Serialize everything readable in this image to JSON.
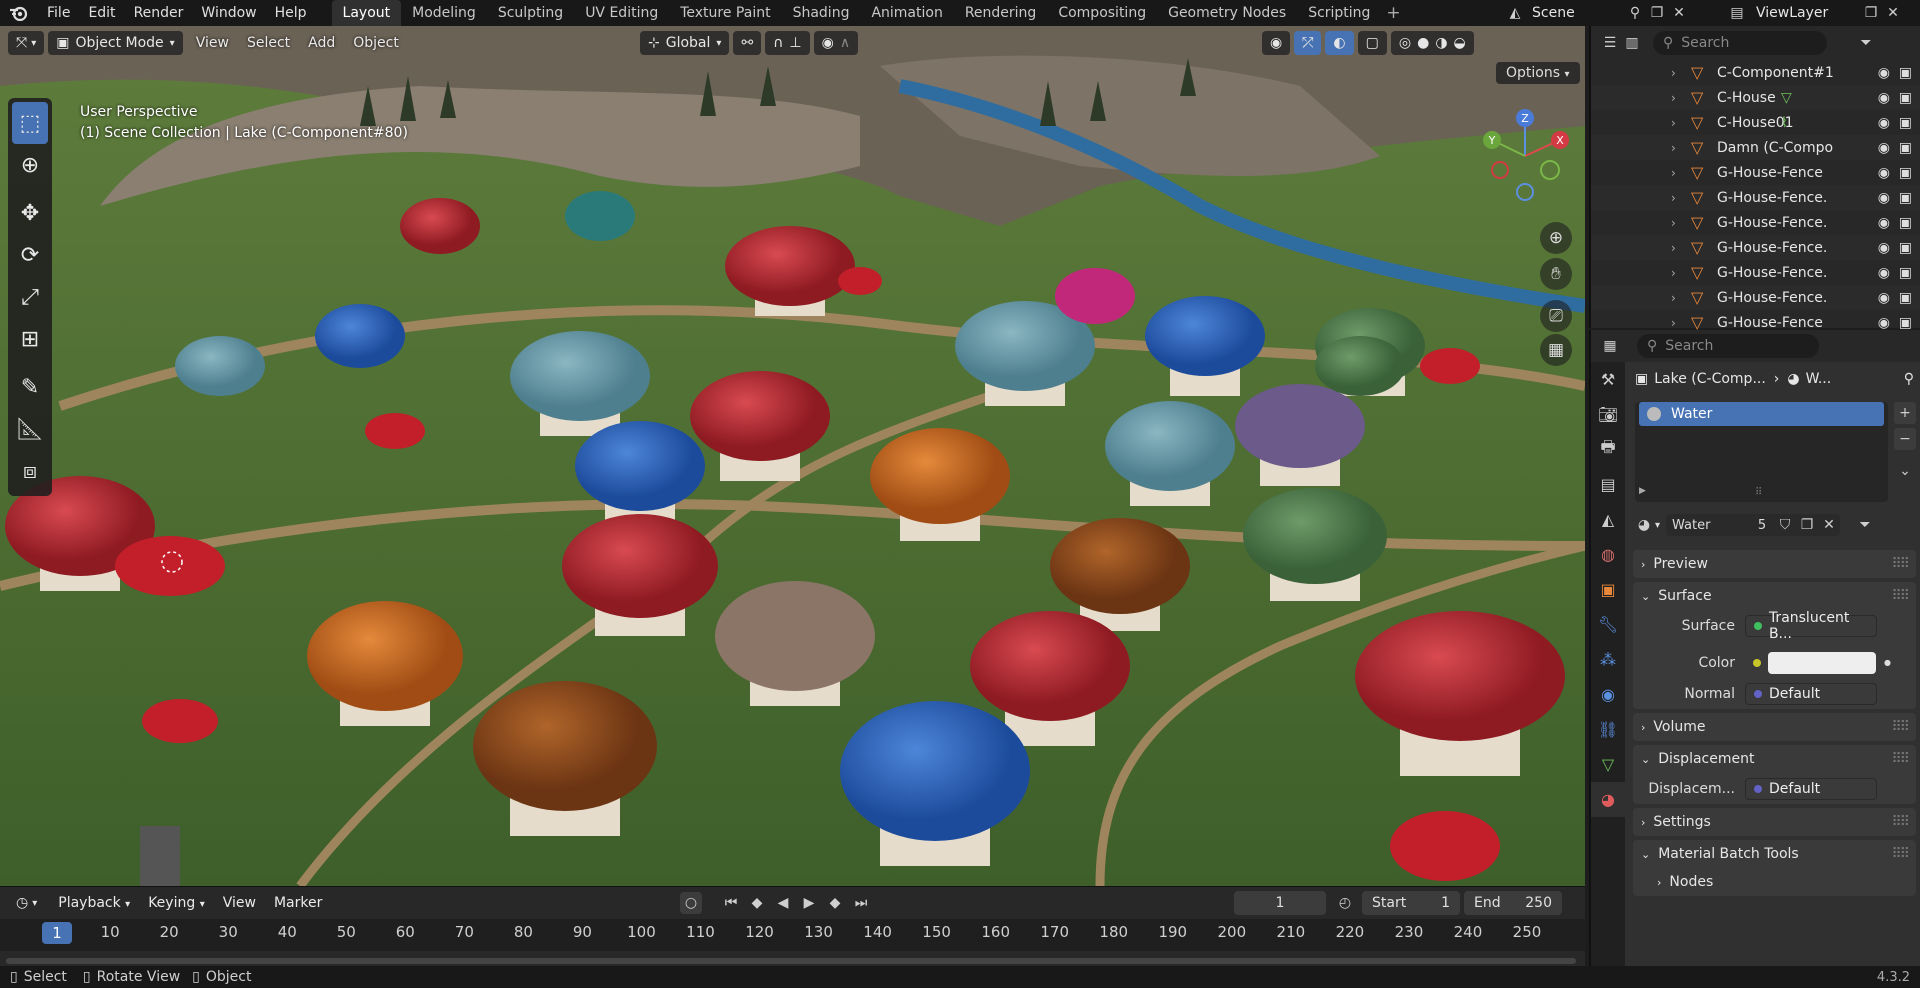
{
  "menu": {
    "file": "File",
    "edit": "Edit",
    "render": "Render",
    "window": "Window",
    "help": "Help"
  },
  "workspaces": [
    "Layout",
    "Modeling",
    "Sculpting",
    "UV Editing",
    "Texture Paint",
    "Shading",
    "Animation",
    "Rendering",
    "Compositing",
    "Geometry Nodes",
    "Scripting"
  ],
  "scene": {
    "name": "Scene",
    "view_layer": "ViewLayer"
  },
  "viewport": {
    "mode": "Object Mode",
    "menus": {
      "view": "View",
      "select": "Select",
      "add": "Add",
      "object": "Object"
    },
    "orientation": "Global",
    "options": "Options",
    "info_line1": "User Perspective",
    "info_line2": "(1) Scene Collection | Lake (C-Component#80)"
  },
  "timeline": {
    "playback": "Playback",
    "keying": "Keying",
    "view": "View",
    "marker": "Marker",
    "current_frame": "1",
    "start_label": "Start",
    "start": "1",
    "end_label": "End",
    "end": "250",
    "ticks": [
      "1",
      "10",
      "20",
      "30",
      "40",
      "50",
      "60",
      "70",
      "80",
      "90",
      "100",
      "110",
      "120",
      "130",
      "140",
      "150",
      "160",
      "170",
      "180",
      "190",
      "200",
      "210",
      "220",
      "230",
      "240",
      "250"
    ]
  },
  "status": {
    "select": "Select",
    "rotate": "Rotate View",
    "object": "Object",
    "version": "4.3.2"
  },
  "outliner": {
    "search_placeholder": "Search",
    "rows": [
      "C-Component#1",
      "C-House",
      "C-House01",
      "Damn (C-Compo",
      "G-House-Fence",
      "G-House-Fence.",
      "G-House-Fence.",
      "G-House-Fence.",
      "G-House-Fence.",
      "G-House-Fence.",
      "G-House-Fence"
    ]
  },
  "properties": {
    "search_placeholder": "Search",
    "breadcrumb_object": "Lake (C-Comp...",
    "breadcrumb_material": "W...",
    "slot": "Water",
    "material_name": "Water",
    "users": "5",
    "panels": {
      "preview": "Preview",
      "surface": "Surface",
      "volume": "Volume",
      "displacement": "Displacement",
      "settings": "Settings",
      "batch": "Material Batch Tools",
      "nodes": "Nodes"
    },
    "surface_label": "Surface",
    "surface_value": "Translucent B...",
    "color_label": "Color",
    "normal_label": "Normal",
    "normal_value": "Default",
    "disp_label": "Displacem...",
    "disp_value": "Default"
  },
  "colors": {
    "accent": "#4772b3",
    "object_orange": "#e7873b",
    "header": "#181818"
  }
}
